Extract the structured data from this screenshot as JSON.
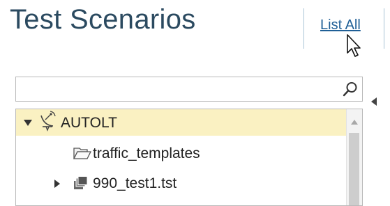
{
  "header": {
    "title": "Test Scenarios",
    "list_all_label": "List All"
  },
  "search": {
    "value": "",
    "placeholder": ""
  },
  "tree": {
    "items": [
      {
        "label": "AUTOLT",
        "icon": "satellite-icon",
        "expander": "expanded",
        "selected": true
      },
      {
        "label": "traffic_templates",
        "icon": "folder-open-icon",
        "expander": "none",
        "selected": false
      },
      {
        "label": "990_test1.tst",
        "icon": "test-file-icon",
        "expander": "collapsed",
        "selected": false
      }
    ]
  },
  "colors": {
    "title": "#2b4a60",
    "link": "#1f5f96",
    "selection": "#faf1c2",
    "divider": "#a9c4d6"
  }
}
